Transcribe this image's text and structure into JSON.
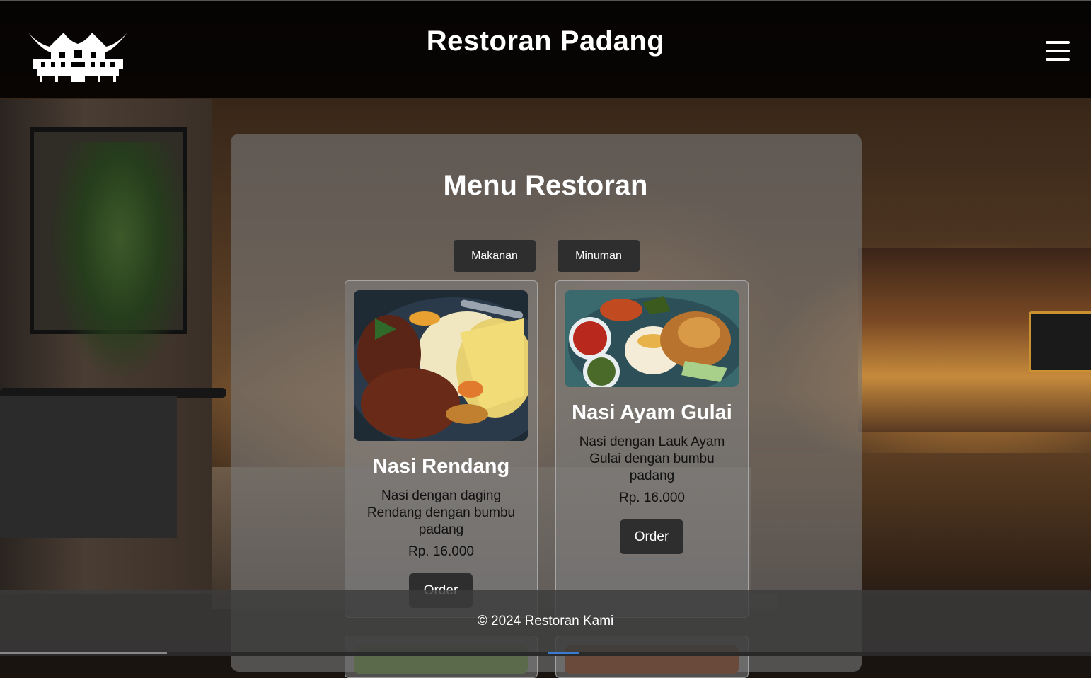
{
  "header": {
    "title": "Restoran Padang",
    "logo_icon": "rumah-gadang-icon",
    "menu_icon": "hamburger-menu-icon"
  },
  "panel": {
    "title": "Menu Restoran"
  },
  "tabs": [
    {
      "label": "Makanan"
    },
    {
      "label": "Minuman"
    }
  ],
  "cards": [
    {
      "name": "Nasi Rendang",
      "description": "Nasi dengan daging Rendang dengan bumbu padang",
      "price": "Rp. 16.000",
      "order_label": "Order",
      "image_icon": "nasi-rendang-photo"
    },
    {
      "name": "Nasi Ayam Gulai",
      "description": "Nasi dengan Lauk Ayam Gulai dengan bumbu padang",
      "price": "Rp. 16.000",
      "order_label": "Order",
      "image_icon": "nasi-ayam-gulai-photo"
    }
  ],
  "footer": {
    "text": "© 2024 Restoran Kami"
  },
  "colors": {
    "header_bg": "#000000",
    "button_bg": "#2e2e2e",
    "panel_bg": "#787878"
  }
}
